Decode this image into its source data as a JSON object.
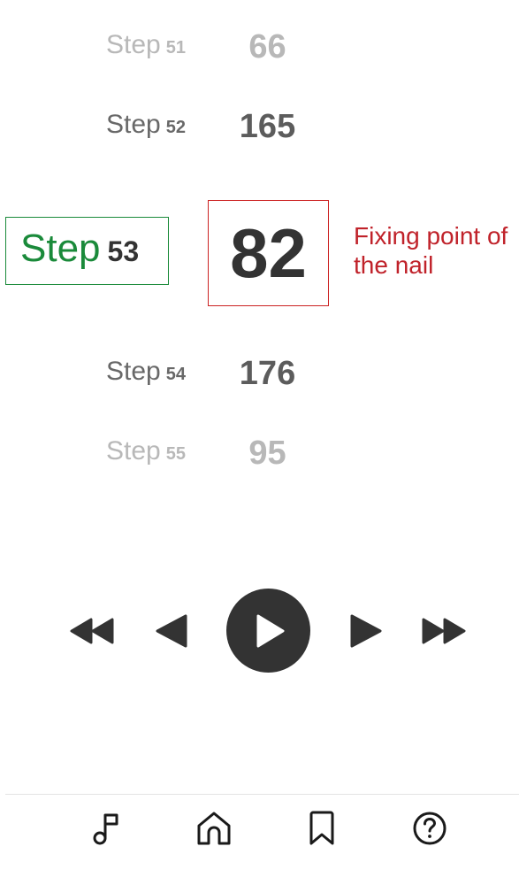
{
  "steps": {
    "word": "Step",
    "previous": [
      {
        "number": "51",
        "value": "66"
      },
      {
        "number": "52",
        "value": "165"
      }
    ],
    "current": {
      "number": "53",
      "value": "82",
      "hint": "Fixing point of the nail"
    },
    "next": [
      {
        "number": "54",
        "value": "176"
      },
      {
        "number": "55",
        "value": "95"
      }
    ]
  },
  "player": {
    "icons": [
      "fast-rewind-icon",
      "previous-icon",
      "play-icon",
      "next-icon",
      "fast-forward-icon"
    ],
    "accent_color": "#333333"
  },
  "tabbar": {
    "tabs": [
      {
        "icon": "music-note-icon"
      },
      {
        "icon": "home-icon"
      },
      {
        "icon": "bookmark-icon"
      },
      {
        "icon": "help-icon"
      }
    ]
  },
  "colors": {
    "current_step_frame": "#1a8a3a",
    "current_value_frame": "#cc2222",
    "hint_text": "#c0222a"
  }
}
